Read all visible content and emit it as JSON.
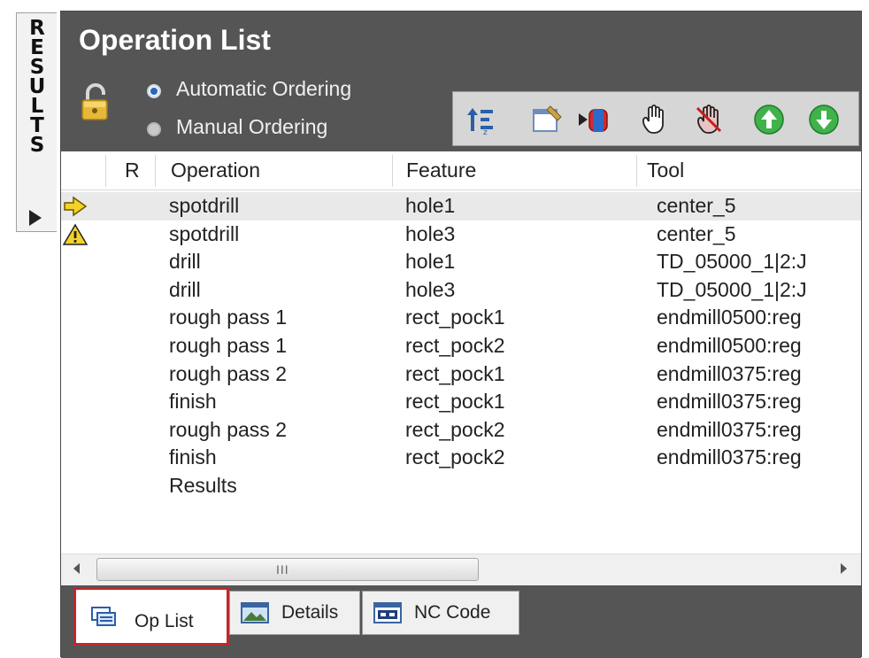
{
  "side_tab": {
    "letters": "RESULTS"
  },
  "panel": {
    "title": "Operation List",
    "ordering": {
      "automatic_label": "Automatic Ordering",
      "manual_label": "Manual Ordering",
      "selected": "automatic"
    }
  },
  "grid": {
    "columns": {
      "r": "R",
      "operation": "Operation",
      "feature": "Feature",
      "tool": "Tool"
    },
    "rows": [
      {
        "status": "current",
        "operation": "spotdrill",
        "feature": "hole1",
        "tool": "center_5"
      },
      {
        "status": "warning",
        "operation": "spotdrill",
        "feature": "hole3",
        "tool": "center_5"
      },
      {
        "status": "",
        "operation": "drill",
        "feature": "hole1",
        "tool": "TD_05000_1|2:J"
      },
      {
        "status": "",
        "operation": "drill",
        "feature": "hole3",
        "tool": "TD_05000_1|2:J"
      },
      {
        "status": "",
        "operation": "rough pass 1",
        "feature": "rect_pock1",
        "tool": "endmill0500:reg"
      },
      {
        "status": "",
        "operation": "rough pass 1",
        "feature": "rect_pock2",
        "tool": "endmill0500:reg"
      },
      {
        "status": "",
        "operation": "rough pass 2",
        "feature": "rect_pock1",
        "tool": "endmill0375:reg"
      },
      {
        "status": "",
        "operation": "finish",
        "feature": "rect_pock1",
        "tool": "endmill0375:reg"
      },
      {
        "status": "",
        "operation": "rough pass 2",
        "feature": "rect_pock2",
        "tool": "endmill0375:reg"
      },
      {
        "status": "",
        "operation": "finish",
        "feature": "rect_pock2",
        "tool": "endmill0375:reg"
      },
      {
        "status": "",
        "operation": "Results",
        "feature": "",
        "tool": ""
      }
    ]
  },
  "scrollbar": {
    "grip": "III"
  },
  "tabs": [
    {
      "label": "Op List",
      "active": true
    },
    {
      "label": "Details",
      "active": false
    },
    {
      "label": "NC Code",
      "active": false
    }
  ],
  "toolbar_icons": [
    "sort-icon",
    "edit-icon",
    "run-icon",
    "hand-icon",
    "no-hand-icon",
    "move-up-icon",
    "move-down-icon"
  ],
  "colors": {
    "panel_bg": "#555555",
    "active_tab_border": "#c0272d",
    "toolbar_green": "#3fb24a"
  }
}
